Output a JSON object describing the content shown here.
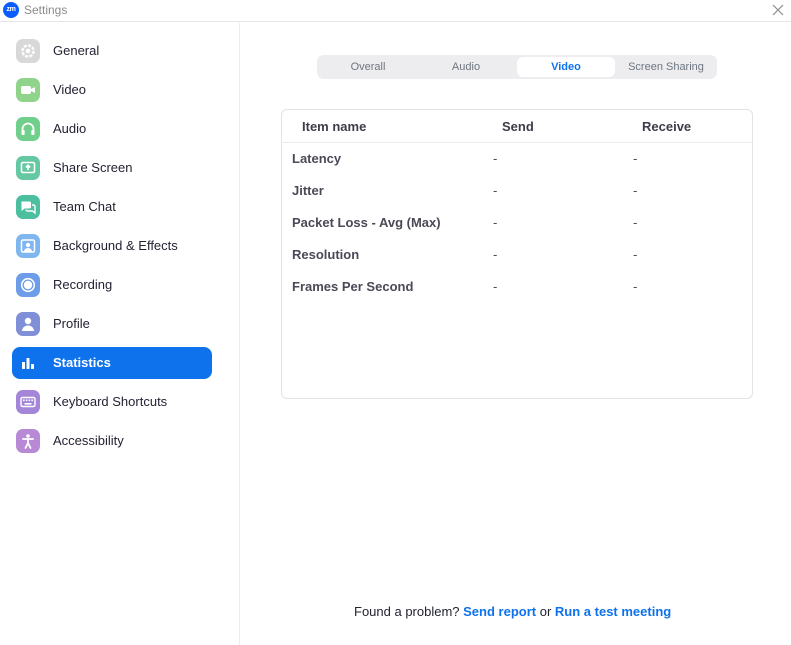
{
  "window": {
    "logo_text": "zm",
    "title": "Settings"
  },
  "sidebar": {
    "items": [
      {
        "label": "General",
        "icon": "gear-icon",
        "color": "#d8d8d8",
        "active": false
      },
      {
        "label": "Video",
        "icon": "video-camera-icon",
        "color": "#8fd48a",
        "active": false
      },
      {
        "label": "Audio",
        "icon": "headphones-icon",
        "color": "#6fcf8b",
        "active": false
      },
      {
        "label": "Share Screen",
        "icon": "share-screen-icon",
        "color": "#66c7a3",
        "active": false
      },
      {
        "label": "Team Chat",
        "icon": "chat-bubbles-icon",
        "color": "#4bbf9f",
        "active": false
      },
      {
        "label": "Background & Effects",
        "icon": "background-person-icon",
        "color": "#7fb6ef",
        "active": false
      },
      {
        "label": "Recording",
        "icon": "record-icon",
        "color": "#6d9ce8",
        "active": false
      },
      {
        "label": "Profile",
        "icon": "profile-icon",
        "color": "#7f8fd8",
        "active": false
      },
      {
        "label": "Statistics",
        "icon": "bar-chart-icon",
        "color": "#0e72ed",
        "active": true
      },
      {
        "label": "Keyboard Shortcuts",
        "icon": "keyboard-icon",
        "color": "#a486d9",
        "active": false
      },
      {
        "label": "Accessibility",
        "icon": "accessibility-icon",
        "color": "#b88ad6",
        "active": false
      }
    ]
  },
  "tabs": [
    {
      "label": "Overall",
      "active": false
    },
    {
      "label": "Audio",
      "active": false
    },
    {
      "label": "Video",
      "active": true
    },
    {
      "label": "Screen Sharing",
      "active": false
    }
  ],
  "stats": {
    "headers": {
      "name": "Item name",
      "send": "Send",
      "receive": "Receive"
    },
    "rows": [
      {
        "name": "Latency",
        "send": "-",
        "receive": "-"
      },
      {
        "name": "Jitter",
        "send": "-",
        "receive": "-"
      },
      {
        "name": "Packet Loss - Avg (Max)",
        "send": "-",
        "receive": "-"
      },
      {
        "name": "Resolution",
        "send": "-",
        "receive": "-"
      },
      {
        "name": "Frames Per Second",
        "send": "-",
        "receive": "-"
      }
    ]
  },
  "footer": {
    "prefix": "Found a problem?",
    "send_report": "Send report",
    "or": "or",
    "run_test": "Run a test meeting"
  },
  "colors": {
    "accent": "#0e72ed",
    "brand": "#0b5cff"
  }
}
